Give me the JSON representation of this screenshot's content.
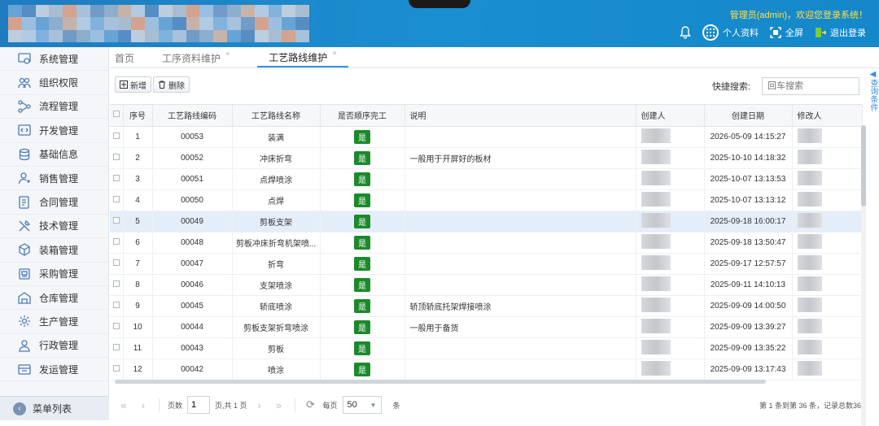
{
  "header": {
    "welcome": "管理员(admin)，欢迎您登录系统！",
    "profile_label": "个人资料",
    "fullscreen_label": "全屏",
    "logout_label": "退出登录"
  },
  "sidebar": {
    "items": [
      {
        "label": "系统管理",
        "icon": "system-settings-icon"
      },
      {
        "label": "组织权限",
        "icon": "users-icon"
      },
      {
        "label": "流程管理",
        "icon": "flow-icon"
      },
      {
        "label": "开发管理",
        "icon": "code-icon"
      },
      {
        "label": "基础信息",
        "icon": "database-icon"
      },
      {
        "label": "销售管理",
        "icon": "sales-user-icon"
      },
      {
        "label": "合同管理",
        "icon": "contract-icon"
      },
      {
        "label": "技术管理",
        "icon": "tools-icon"
      },
      {
        "label": "装箱管理",
        "icon": "box-icon"
      },
      {
        "label": "采购管理",
        "icon": "purchase-icon"
      },
      {
        "label": "仓库管理",
        "icon": "warehouse-icon"
      },
      {
        "label": "生产管理",
        "icon": "production-gear-icon"
      },
      {
        "label": "行政管理",
        "icon": "admin-user-icon"
      },
      {
        "label": "发运管理",
        "icon": "shipping-icon"
      }
    ],
    "footer_label": "菜单列表"
  },
  "tabs": [
    {
      "label": "首页",
      "closable": false,
      "active": false
    },
    {
      "label": "工序资料维护",
      "closable": true,
      "active": false
    },
    {
      "label": "工艺路线维护",
      "closable": true,
      "active": true
    }
  ],
  "toolbar": {
    "add_label": "新增",
    "delete_label": "删除"
  },
  "search": {
    "label": "快捷搜索:",
    "placeholder": "回车搜索"
  },
  "query_panel_label": "查询条件",
  "table": {
    "headers": [
      "序号",
      "工艺路线编码",
      "工艺路线名称",
      "是否顺序完工",
      "说明",
      "创建人",
      "创建日期",
      "修改人"
    ],
    "rows": [
      {
        "no": "1",
        "code": "00053",
        "name": "装满",
        "seq": "是",
        "desc": "",
        "date": "2026-05-09 14:15:27"
      },
      {
        "no": "2",
        "code": "00052",
        "name": "冲床折弯",
        "seq": "是",
        "desc": "一般用于开屏好的板材",
        "date": "2025-10-10 14:18:32"
      },
      {
        "no": "3",
        "code": "00051",
        "name": "点焊喷涂",
        "seq": "是",
        "desc": "",
        "date": "2025-10-07 13:13:53"
      },
      {
        "no": "4",
        "code": "00050",
        "name": "点焊",
        "seq": "是",
        "desc": "",
        "date": "2025-10-07 13:13:12"
      },
      {
        "no": "5",
        "code": "00049",
        "name": "剪板支架",
        "seq": "是",
        "desc": "",
        "date": "2025-09-18 16:00:17"
      },
      {
        "no": "6",
        "code": "00048",
        "name": "剪板冲床折弯机架喷...",
        "seq": "是",
        "desc": "",
        "date": "2025-09-18 13:50:47"
      },
      {
        "no": "7",
        "code": "00047",
        "name": "折弯",
        "seq": "是",
        "desc": "",
        "date": "2025-09-17 12:57:57"
      },
      {
        "no": "8",
        "code": "00046",
        "name": "支架喷涂",
        "seq": "是",
        "desc": "",
        "date": "2025-09-11 14:10:13"
      },
      {
        "no": "9",
        "code": "00045",
        "name": "轿底喷涂",
        "seq": "是",
        "desc": "轿顶轿底托架焊接喷涂",
        "date": "2025-09-09 14:00:50"
      },
      {
        "no": "10",
        "code": "00044",
        "name": "剪板支架折弯喷涂",
        "seq": "是",
        "desc": "一般用于备货",
        "date": "2025-09-09 13:39:27"
      },
      {
        "no": "11",
        "code": "00043",
        "name": "剪板",
        "seq": "是",
        "desc": "",
        "date": "2025-09-09 13:35:22"
      },
      {
        "no": "12",
        "code": "00042",
        "name": "喷涂",
        "seq": "是",
        "desc": "",
        "date": "2025-09-09 13:17:43"
      }
    ],
    "selected_row": 5
  },
  "pager": {
    "page_label": "页数",
    "current_page": "1",
    "total_pages_text": "页,共 1 页",
    "per_page_label": "每页",
    "per_page_value": "50",
    "unit_label": "条",
    "info": "第 1 条到第 36 条，记录总数36"
  },
  "colors": {
    "header_bg": "#1a8fd0",
    "welcome_text": "#ffe14a",
    "badge_green": "#1a8a2a",
    "selected_row_bg": "#e4eef9",
    "active_tab_underline": "#3a8ee6"
  }
}
